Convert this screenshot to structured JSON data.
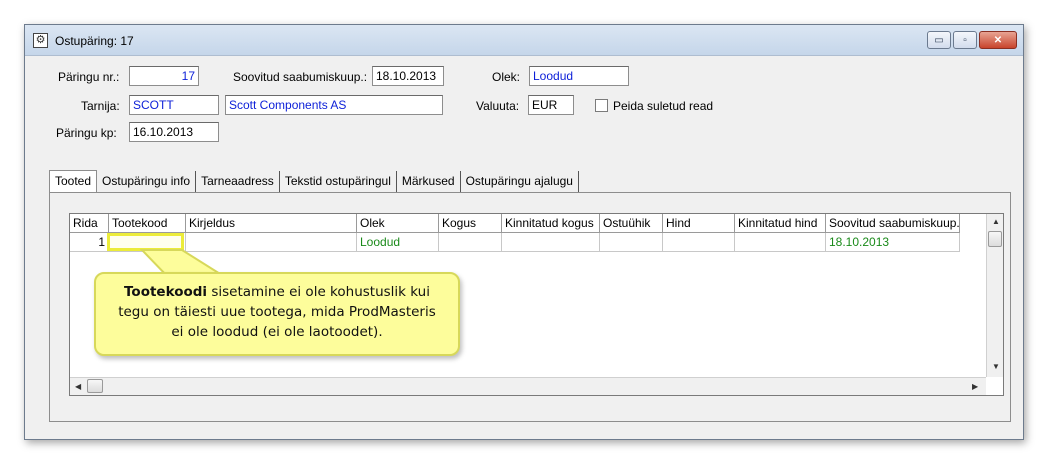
{
  "window": {
    "title": "Ostupäring: 17",
    "buttons": {
      "minimize": "▭",
      "maximize": "▫",
      "close": "✕"
    }
  },
  "form": {
    "request_no_label": "Päringu nr.:",
    "request_no_value": "17",
    "arrival_label": "Soovitud saabumiskuup.:",
    "arrival_value": "18.10.2013",
    "status_label": "Olek:",
    "status_value": "Loodud",
    "supplier_label": "Tarnija:",
    "supplier_code": "SCOTT",
    "supplier_name": "Scott Components AS",
    "currency_label": "Valuuta:",
    "currency_value": "EUR",
    "hide_closed_label": "Peida suletud read",
    "date_label": "Päringu kp:",
    "date_value": "16.10.2013"
  },
  "tabs": [
    "Tooted",
    "Ostupäringu info",
    "Tarneaadress",
    "Tekstid ostupäringul",
    "Märkused",
    "Ostupäringu ajalugu"
  ],
  "grid": {
    "headers": [
      "Rida",
      "Tootekood",
      "Kirjeldus",
      "Olek",
      "Kogus",
      "Kinnitatud kogus",
      "Ostuühik",
      "Hind",
      "Kinnitatud hind",
      "Soovitud saabumiskuup."
    ],
    "rows": [
      [
        "1",
        "",
        "",
        "Loodud",
        "",
        "",
        "",
        "",
        "",
        "18.10.2013"
      ]
    ]
  },
  "callout": {
    "bold": "Tootekoodi",
    "text_1": " sisetamine ei ole kohustuslik kui",
    "text_2": "tegu on täiesti uue tootega, mida ProdMasteris",
    "text_3": "ei ole loodud (ei ole laotoodet)."
  },
  "colors": {
    "field_blue": "#0b1ed8",
    "status_green": "#1a8a1a",
    "callout_bg": "#fdfd9b",
    "highlight": "#ecec3a"
  }
}
